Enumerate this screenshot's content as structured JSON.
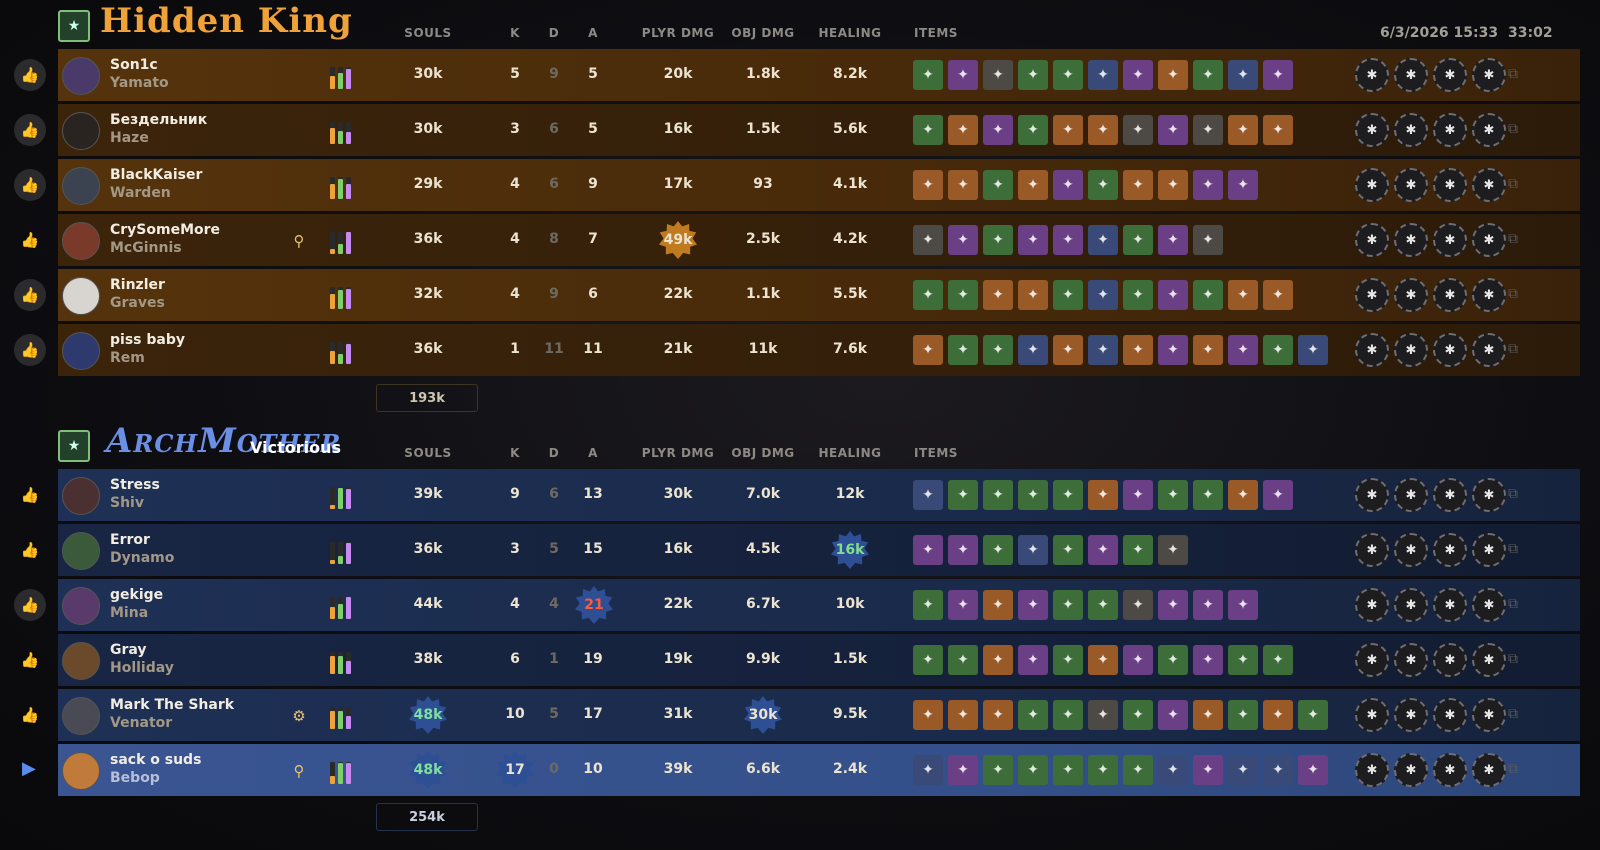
{
  "header": {
    "date": "6/3/2026 15:33",
    "duration": "33:02"
  },
  "columns": {
    "souls": "SOULS",
    "k": "K",
    "d": "D",
    "a": "A",
    "plyr_dmg": "PLYR DMG",
    "obj_dmg": "OBJ DMG",
    "healing": "HEALING",
    "items": "ITEMS"
  },
  "teams": [
    {
      "name": "Hidden King",
      "status": "",
      "total_souls": "193k",
      "players": [
        {
          "name": "Son1c",
          "hero": "Yamato",
          "souls": "30k",
          "k": "5",
          "d": "9",
          "a": "5",
          "plyr_dmg": "20k",
          "obj_dmg": "1.8k",
          "healing": "8.2k",
          "item_count": 11
        },
        {
          "name": "Бездельник",
          "hero": "Haze",
          "souls": "30k",
          "k": "3",
          "d": "6",
          "a": "5",
          "plyr_dmg": "16k",
          "obj_dmg": "1.5k",
          "healing": "5.6k",
          "item_count": 11
        },
        {
          "name": "BlackKaiser",
          "hero": "Warden",
          "souls": "29k",
          "k": "4",
          "d": "6",
          "a": "9",
          "plyr_dmg": "17k",
          "obj_dmg": "93",
          "healing": "4.1k",
          "item_count": 10
        },
        {
          "name": "CrySomeMore",
          "hero": "McGinnis",
          "souls": "36k",
          "k": "4",
          "d": "8",
          "a": "7",
          "plyr_dmg": "49k",
          "obj_dmg": "2.5k",
          "healing": "4.2k",
          "item_count": 9
        },
        {
          "name": "Rinzler",
          "hero": "Graves",
          "souls": "32k",
          "k": "4",
          "d": "9",
          "a": "6",
          "plyr_dmg": "22k",
          "obj_dmg": "1.1k",
          "healing": "5.5k",
          "item_count": 11
        },
        {
          "name": "piss baby",
          "hero": "Rem",
          "souls": "36k",
          "k": "1",
          "d": "11",
          "a": "11",
          "plyr_dmg": "21k",
          "obj_dmg": "11k",
          "healing": "7.6k",
          "item_count": 12
        }
      ]
    },
    {
      "name": "ArchMother",
      "status": "Victorious",
      "total_souls": "254k",
      "players": [
        {
          "name": "Stress",
          "hero": "Shiv",
          "souls": "39k",
          "k": "9",
          "d": "6",
          "a": "13",
          "plyr_dmg": "30k",
          "obj_dmg": "7.0k",
          "healing": "12k",
          "item_count": 11
        },
        {
          "name": "Error",
          "hero": "Dynamo",
          "souls": "36k",
          "k": "3",
          "d": "5",
          "a": "15",
          "plyr_dmg": "16k",
          "obj_dmg": "4.5k",
          "healing": "16k",
          "item_count": 8
        },
        {
          "name": "gekige",
          "hero": "Mina",
          "souls": "44k",
          "k": "4",
          "d": "4",
          "a": "21",
          "plyr_dmg": "22k",
          "obj_dmg": "6.7k",
          "healing": "10k",
          "item_count": 10
        },
        {
          "name": "Gray",
          "hero": "Holliday",
          "souls": "38k",
          "k": "6",
          "d": "1",
          "a": "19",
          "plyr_dmg": "19k",
          "obj_dmg": "9.9k",
          "healing": "1.5k",
          "item_count": 11
        },
        {
          "name": "Mark The Shark",
          "hero": "Venator",
          "souls": "48k",
          "k": "10",
          "d": "5",
          "a": "17",
          "plyr_dmg": "31k",
          "obj_dmg": "30k",
          "healing": "9.5k",
          "item_count": 12
        },
        {
          "name": "sack o suds",
          "hero": "Bebop",
          "souls": "48k",
          "k": "17",
          "d": "0",
          "a": "10",
          "plyr_dmg": "39k",
          "obj_dmg": "6.6k",
          "healing": "2.4k",
          "item_count": 12
        }
      ]
    }
  ]
}
